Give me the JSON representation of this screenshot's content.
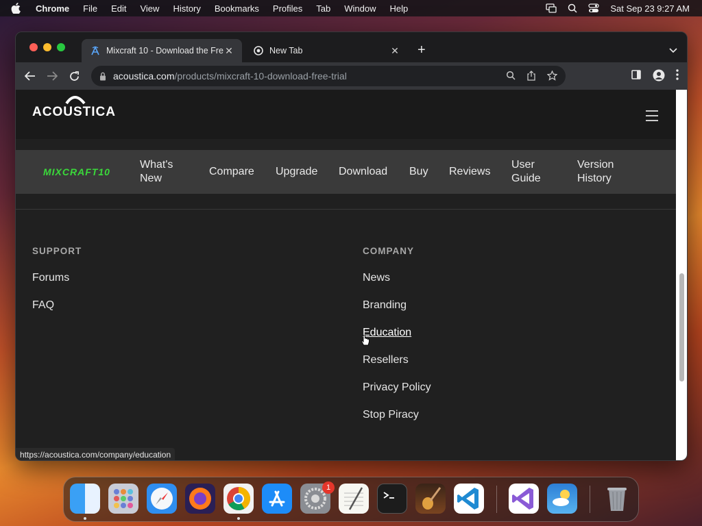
{
  "menubar": {
    "app": "Chrome",
    "items": [
      "File",
      "Edit",
      "View",
      "History",
      "Bookmarks",
      "Profiles",
      "Tab",
      "Window",
      "Help"
    ],
    "clock": "Sat Sep 23  9:27 AM"
  },
  "tabs": [
    {
      "title": "Mixcraft 10 - Download the Fre",
      "active": true
    },
    {
      "title": "New Tab",
      "active": false
    }
  ],
  "omnibox": {
    "host": "acoustica.com",
    "path": "/products/mixcraft-10-download-free-trial"
  },
  "site": {
    "logo": "ACOUSTICA",
    "product_logo": "MIXCRAFT10",
    "nav": [
      {
        "line1": "What's",
        "line2": "New"
      },
      {
        "line1": "Compare",
        "line2": ""
      },
      {
        "line1": "Upgrade",
        "line2": ""
      },
      {
        "line1": "Download",
        "line2": ""
      },
      {
        "line1": "Buy",
        "line2": ""
      },
      {
        "line1": "Reviews",
        "line2": ""
      },
      {
        "line1": "User",
        "line2": "Guide"
      },
      {
        "line1": "Version",
        "line2": "History"
      }
    ],
    "support": {
      "heading": "SUPPORT",
      "links": [
        "Forums",
        "FAQ"
      ]
    },
    "company": {
      "heading": "COMPANY",
      "links": [
        "News",
        "Branding",
        "Education",
        "Resellers",
        "Privacy Policy",
        "Stop Piracy"
      ]
    }
  },
  "status_url": "https://acoustica.com/company/education",
  "dock": {
    "apps": [
      "Finder",
      "Launchpad",
      "Safari",
      "Firefox",
      "Chrome",
      "App Store",
      "System Settings",
      "TextEdit",
      "Terminal",
      "GarageBand",
      "VS Code",
      "Visual Studio",
      "Weather",
      "Trash"
    ],
    "settings_badge": "1"
  },
  "colors": {
    "accent_green": "#3ad93a",
    "page_bg": "#202020"
  }
}
